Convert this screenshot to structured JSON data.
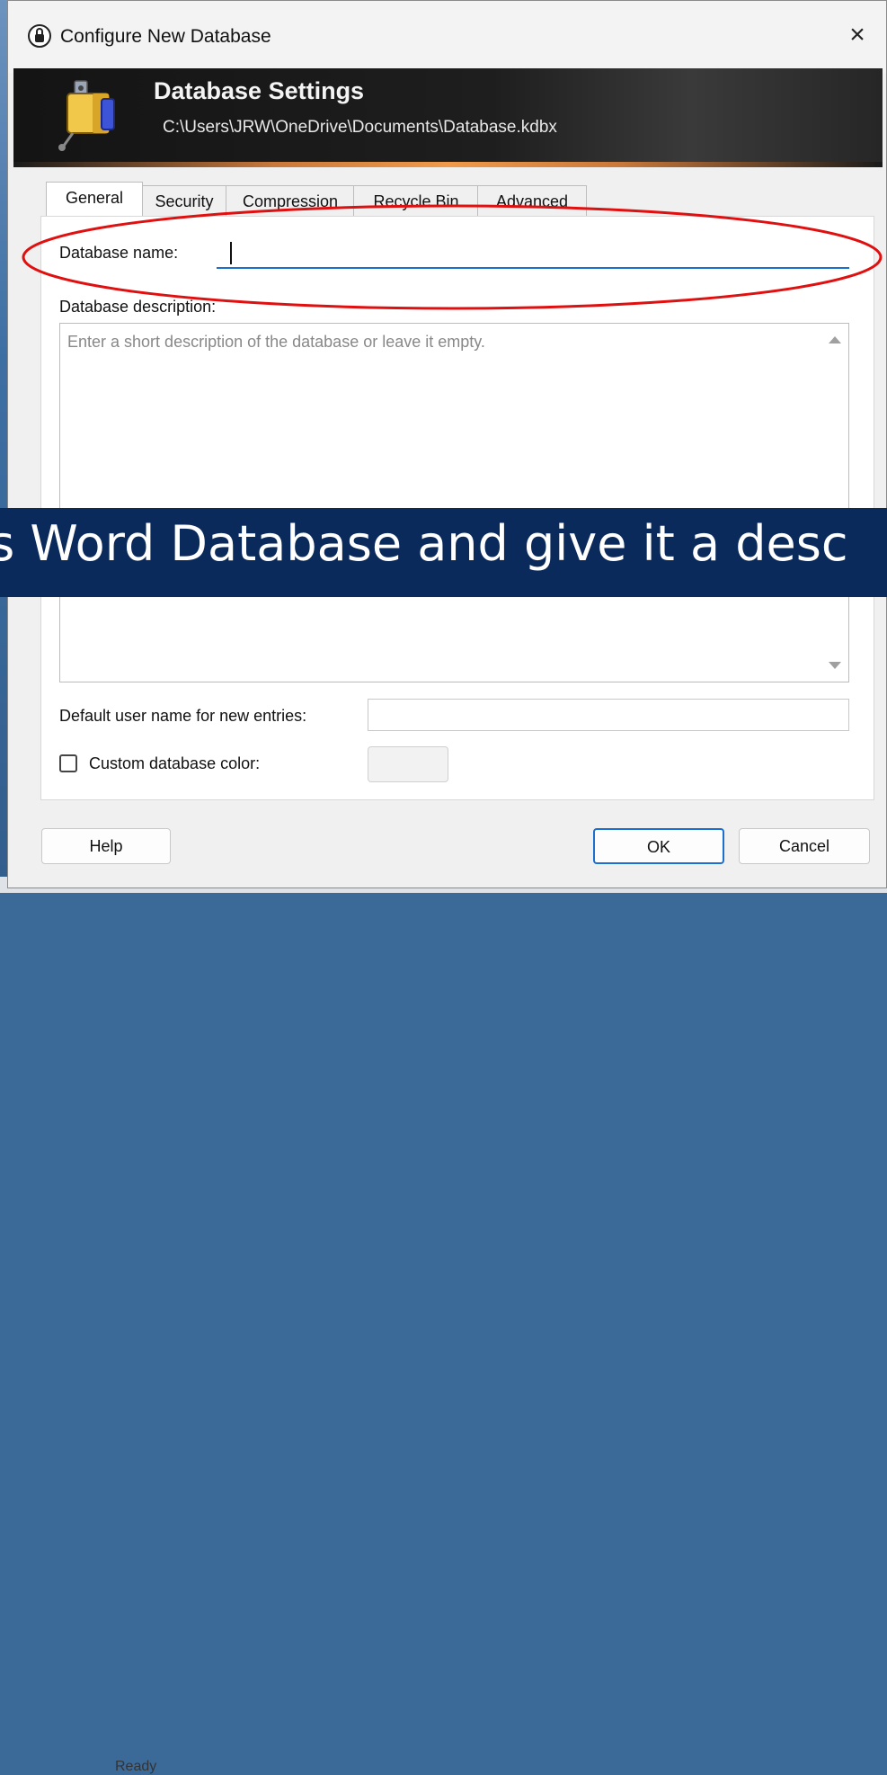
{
  "window": {
    "title": "Configure New Database",
    "close_glyph": "×"
  },
  "banner": {
    "title": "Database Settings",
    "path": "C:\\Users\\JRW\\OneDrive\\Documents\\Database.kdbx"
  },
  "tabs": [
    {
      "label": "General",
      "active": true
    },
    {
      "label": "Security",
      "active": false
    },
    {
      "label": "Compression",
      "active": false
    },
    {
      "label": "Recycle Bin",
      "active": false
    },
    {
      "label": "Advanced",
      "active": false
    }
  ],
  "general": {
    "name_label": "Database name:",
    "name_value": "",
    "description_label": "Database description:",
    "description_placeholder": "Enter a short description of the database or leave it empty.",
    "default_user_label": "Default user name for new entries:",
    "default_user_value": "",
    "custom_color_label": "Custom database color:",
    "custom_color_checked": false
  },
  "buttons": {
    "help": "Help",
    "ok": "OK",
    "cancel": "Cancel"
  },
  "status": {
    "text": "Ready"
  },
  "caption": {
    "text": "ss Word Database and give it a desc"
  },
  "colors": {
    "accent": "#1a6fcf",
    "annotation": "#e01010",
    "caption_bg": "#0b2a5c"
  },
  "icons": [
    "lock-icon",
    "close-icon",
    "database-icon",
    "scroll-up-icon",
    "scroll-down-icon"
  ]
}
